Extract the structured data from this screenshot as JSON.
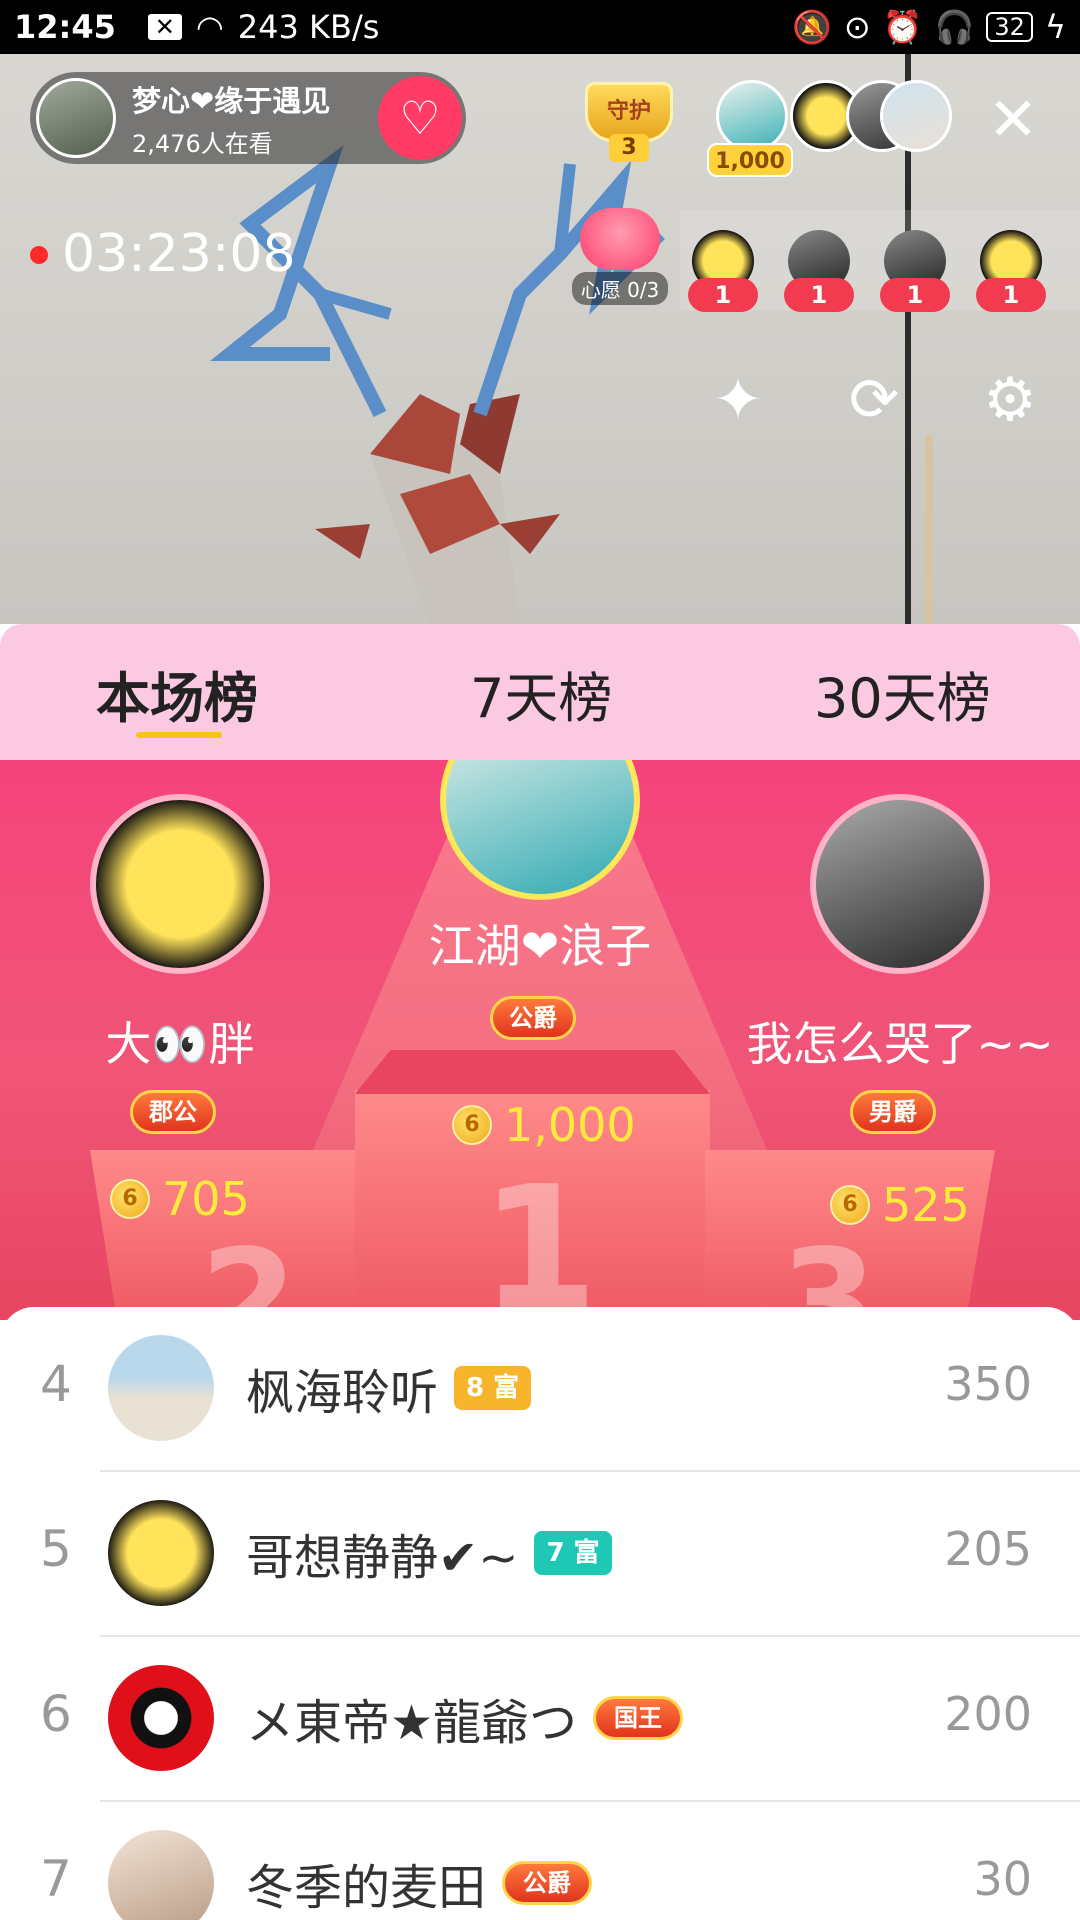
{
  "status_bar": {
    "time": "12:45",
    "network_speed": "243 KB/s",
    "battery": "32"
  },
  "live": {
    "host_name": "梦心❤缘于遇见",
    "viewer_count": "2,476人在看",
    "guard_label": "守护",
    "guard_count": "3",
    "top_coins": "1,000",
    "timer": "03:23:08",
    "wish_label": "心愿 0/3",
    "gift_counts": [
      "1",
      "1",
      "1",
      "1"
    ]
  },
  "tabs": [
    {
      "label": "本场榜"
    },
    {
      "label": "7天榜"
    },
    {
      "label": "30天榜"
    }
  ],
  "podium": {
    "first": {
      "name": "江湖❤浪子",
      "title": "公爵",
      "score": "1,000"
    },
    "second": {
      "name": "大👀胖",
      "title": "郡公",
      "score": "705"
    },
    "third": {
      "name": "我怎么哭了~~",
      "title": "男爵",
      "score": "525"
    },
    "rank_digits": [
      "1",
      "2",
      "3"
    ],
    "coin_glyph": "6"
  },
  "ranking": [
    {
      "rank": "4",
      "name": "枫海聆听",
      "badge": "8 富",
      "badge_color": "#f7b52c",
      "score": "350"
    },
    {
      "rank": "5",
      "name": "哥想静静✔~",
      "badge": "7 富",
      "badge_color": "#1fc8b4",
      "score": "205"
    },
    {
      "rank": "6",
      "name": "メ東帝★龍爺つ",
      "badge": "国王",
      "badge_color": "#e0331d",
      "score": "200"
    },
    {
      "rank": "7",
      "name": "冬季的麦田",
      "badge": "公爵",
      "badge_color": "#e0331d",
      "score": "30"
    }
  ]
}
